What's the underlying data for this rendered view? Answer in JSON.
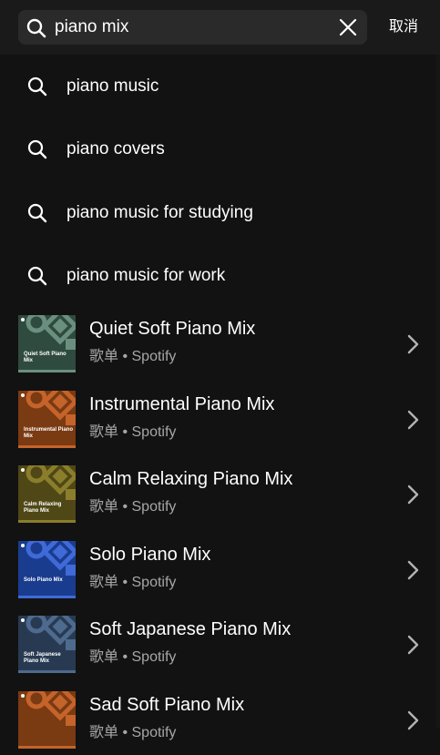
{
  "search": {
    "query": "piano mix",
    "cancel_label": "取消"
  },
  "suggestions": [
    {
      "label": "piano music"
    },
    {
      "label": "piano covers"
    },
    {
      "label": "piano music for studying"
    },
    {
      "label": "piano music for work"
    }
  ],
  "playlists": [
    {
      "title": "Quiet Soft Piano Mix",
      "type": "歌单",
      "owner": "Spotify",
      "cover_text": "Quiet Soft Piano Mix",
      "cover_color": "#2f4a3e",
      "accent_color": "#6a8f7f"
    },
    {
      "title": "Instrumental Piano Mix",
      "type": "歌单",
      "owner": "Spotify",
      "cover_text": "Instrumental Piano Mix",
      "cover_color": "#7a3a12",
      "accent_color": "#c4632a"
    },
    {
      "title": "Calm Relaxing Piano Mix",
      "type": "歌单",
      "owner": "Spotify",
      "cover_text": "Calm Relaxing Piano Mix",
      "cover_color": "#4f4715",
      "accent_color": "#8a7d2c"
    },
    {
      "title": "Solo Piano Mix",
      "type": "歌单",
      "owner": "Spotify",
      "cover_text": "Solo Piano Mix",
      "cover_color": "#1a3c8f",
      "accent_color": "#3f6ad8"
    },
    {
      "title": "Soft Japanese Piano Mix",
      "type": "歌单",
      "owner": "Spotify",
      "cover_text": "Soft Japanese Piano Mix",
      "cover_color": "#283a52",
      "accent_color": "#4e6a8e"
    },
    {
      "title": "Sad Soft Piano Mix",
      "type": "歌单",
      "owner": "Spotify",
      "cover_text": "",
      "cover_color": "#7a3a12",
      "accent_color": "#c4632a"
    }
  ],
  "separator": "•"
}
